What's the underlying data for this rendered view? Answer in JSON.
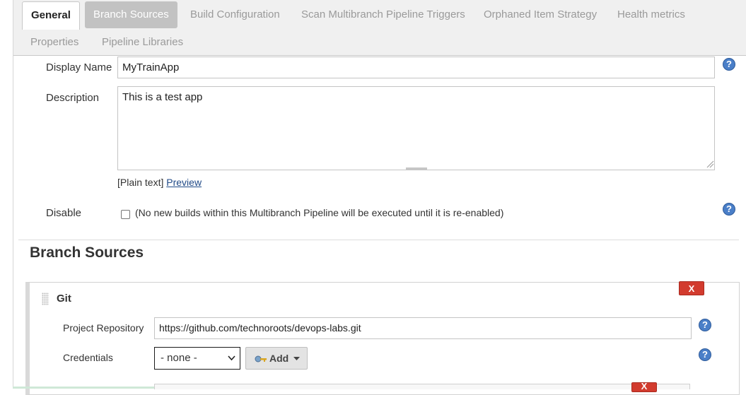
{
  "tabs": [
    {
      "label": "General",
      "state": "active"
    },
    {
      "label": "Branch Sources",
      "state": "highlighted"
    },
    {
      "label": "Build Configuration",
      "state": "normal"
    },
    {
      "label": "Scan Multibranch Pipeline Triggers",
      "state": "normal"
    },
    {
      "label": "Orphaned Item Strategy",
      "state": "normal"
    },
    {
      "label": "Health metrics",
      "state": "normal"
    },
    {
      "label": "Properties",
      "state": "normal"
    },
    {
      "label": "Pipeline Libraries",
      "state": "normal"
    }
  ],
  "general": {
    "display_name_label": "Display Name",
    "display_name_value": "MyTrainApp",
    "description_label": "Description",
    "description_value": "This is a test app",
    "plain_text": "[Plain text]",
    "preview_link": "Preview",
    "disable_label": "Disable",
    "disable_checked": false,
    "disable_note": "(No new builds within this Multibranch Pipeline will be executed until it is re-enabled)"
  },
  "branch_sources": {
    "title": "Branch Sources",
    "git": {
      "title": "Git",
      "delete_label": "X",
      "repo_label": "Project Repository",
      "repo_value": "https://github.com/technoroots/devops-labs.git",
      "credentials_label": "Credentials",
      "credentials_selected": "- none -",
      "add_label": "Add"
    }
  },
  "help_glyph": "?",
  "colors": {
    "delete_button": "#d23b2e",
    "help_icon": "#4a7fc8",
    "active_tab": "#ffffff",
    "highlighted_tab": "#c2c2c2",
    "link": "#204a87"
  },
  "icons": [
    "help-icon",
    "key-icon",
    "chevron-down-icon",
    "caret-down-icon",
    "drag-handle-icon",
    "resize-handle-icon"
  ]
}
